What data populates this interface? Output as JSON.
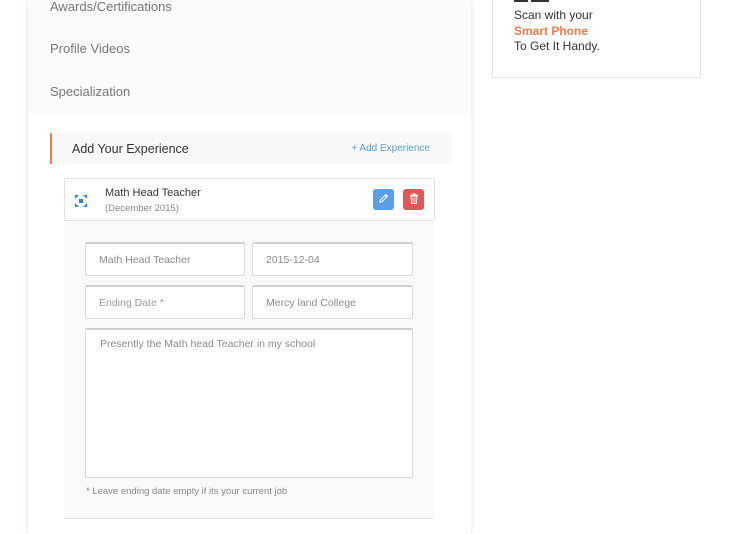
{
  "profile_menu": {
    "items": [
      {
        "label": "Awards/Certifications"
      },
      {
        "label": "Profile Videos"
      },
      {
        "label": "Specialization"
      }
    ]
  },
  "experience": {
    "section_title": "Add Your Experience",
    "add_link": "+ Add Experience",
    "item": {
      "title": "Math Head Teacher",
      "date": "(December 2015)"
    },
    "form": {
      "job_title_value": "Math Head Teacher",
      "start_date_value": "2015-12-04",
      "end_date_placeholder": "Ending Date *",
      "end_date_value": "",
      "institution_value": "Mercy land College",
      "description_value": "Presently the Math head Teacher in my school",
      "hint": "* Leave ending date empty if its your current job"
    }
  },
  "qr_card": {
    "line1": "Scan with your",
    "line2": "Smart Phone",
    "line3": "To Get It Handy."
  },
  "colors": {
    "accent": "#f07c4a",
    "link": "#5a9fd4",
    "edit_button": "#5a9ee6",
    "delete_button": "#e25656",
    "move_icon": "#2a86d8"
  },
  "icons": {
    "move": "move-icon",
    "edit": "pencil-icon",
    "delete": "trash-icon"
  }
}
